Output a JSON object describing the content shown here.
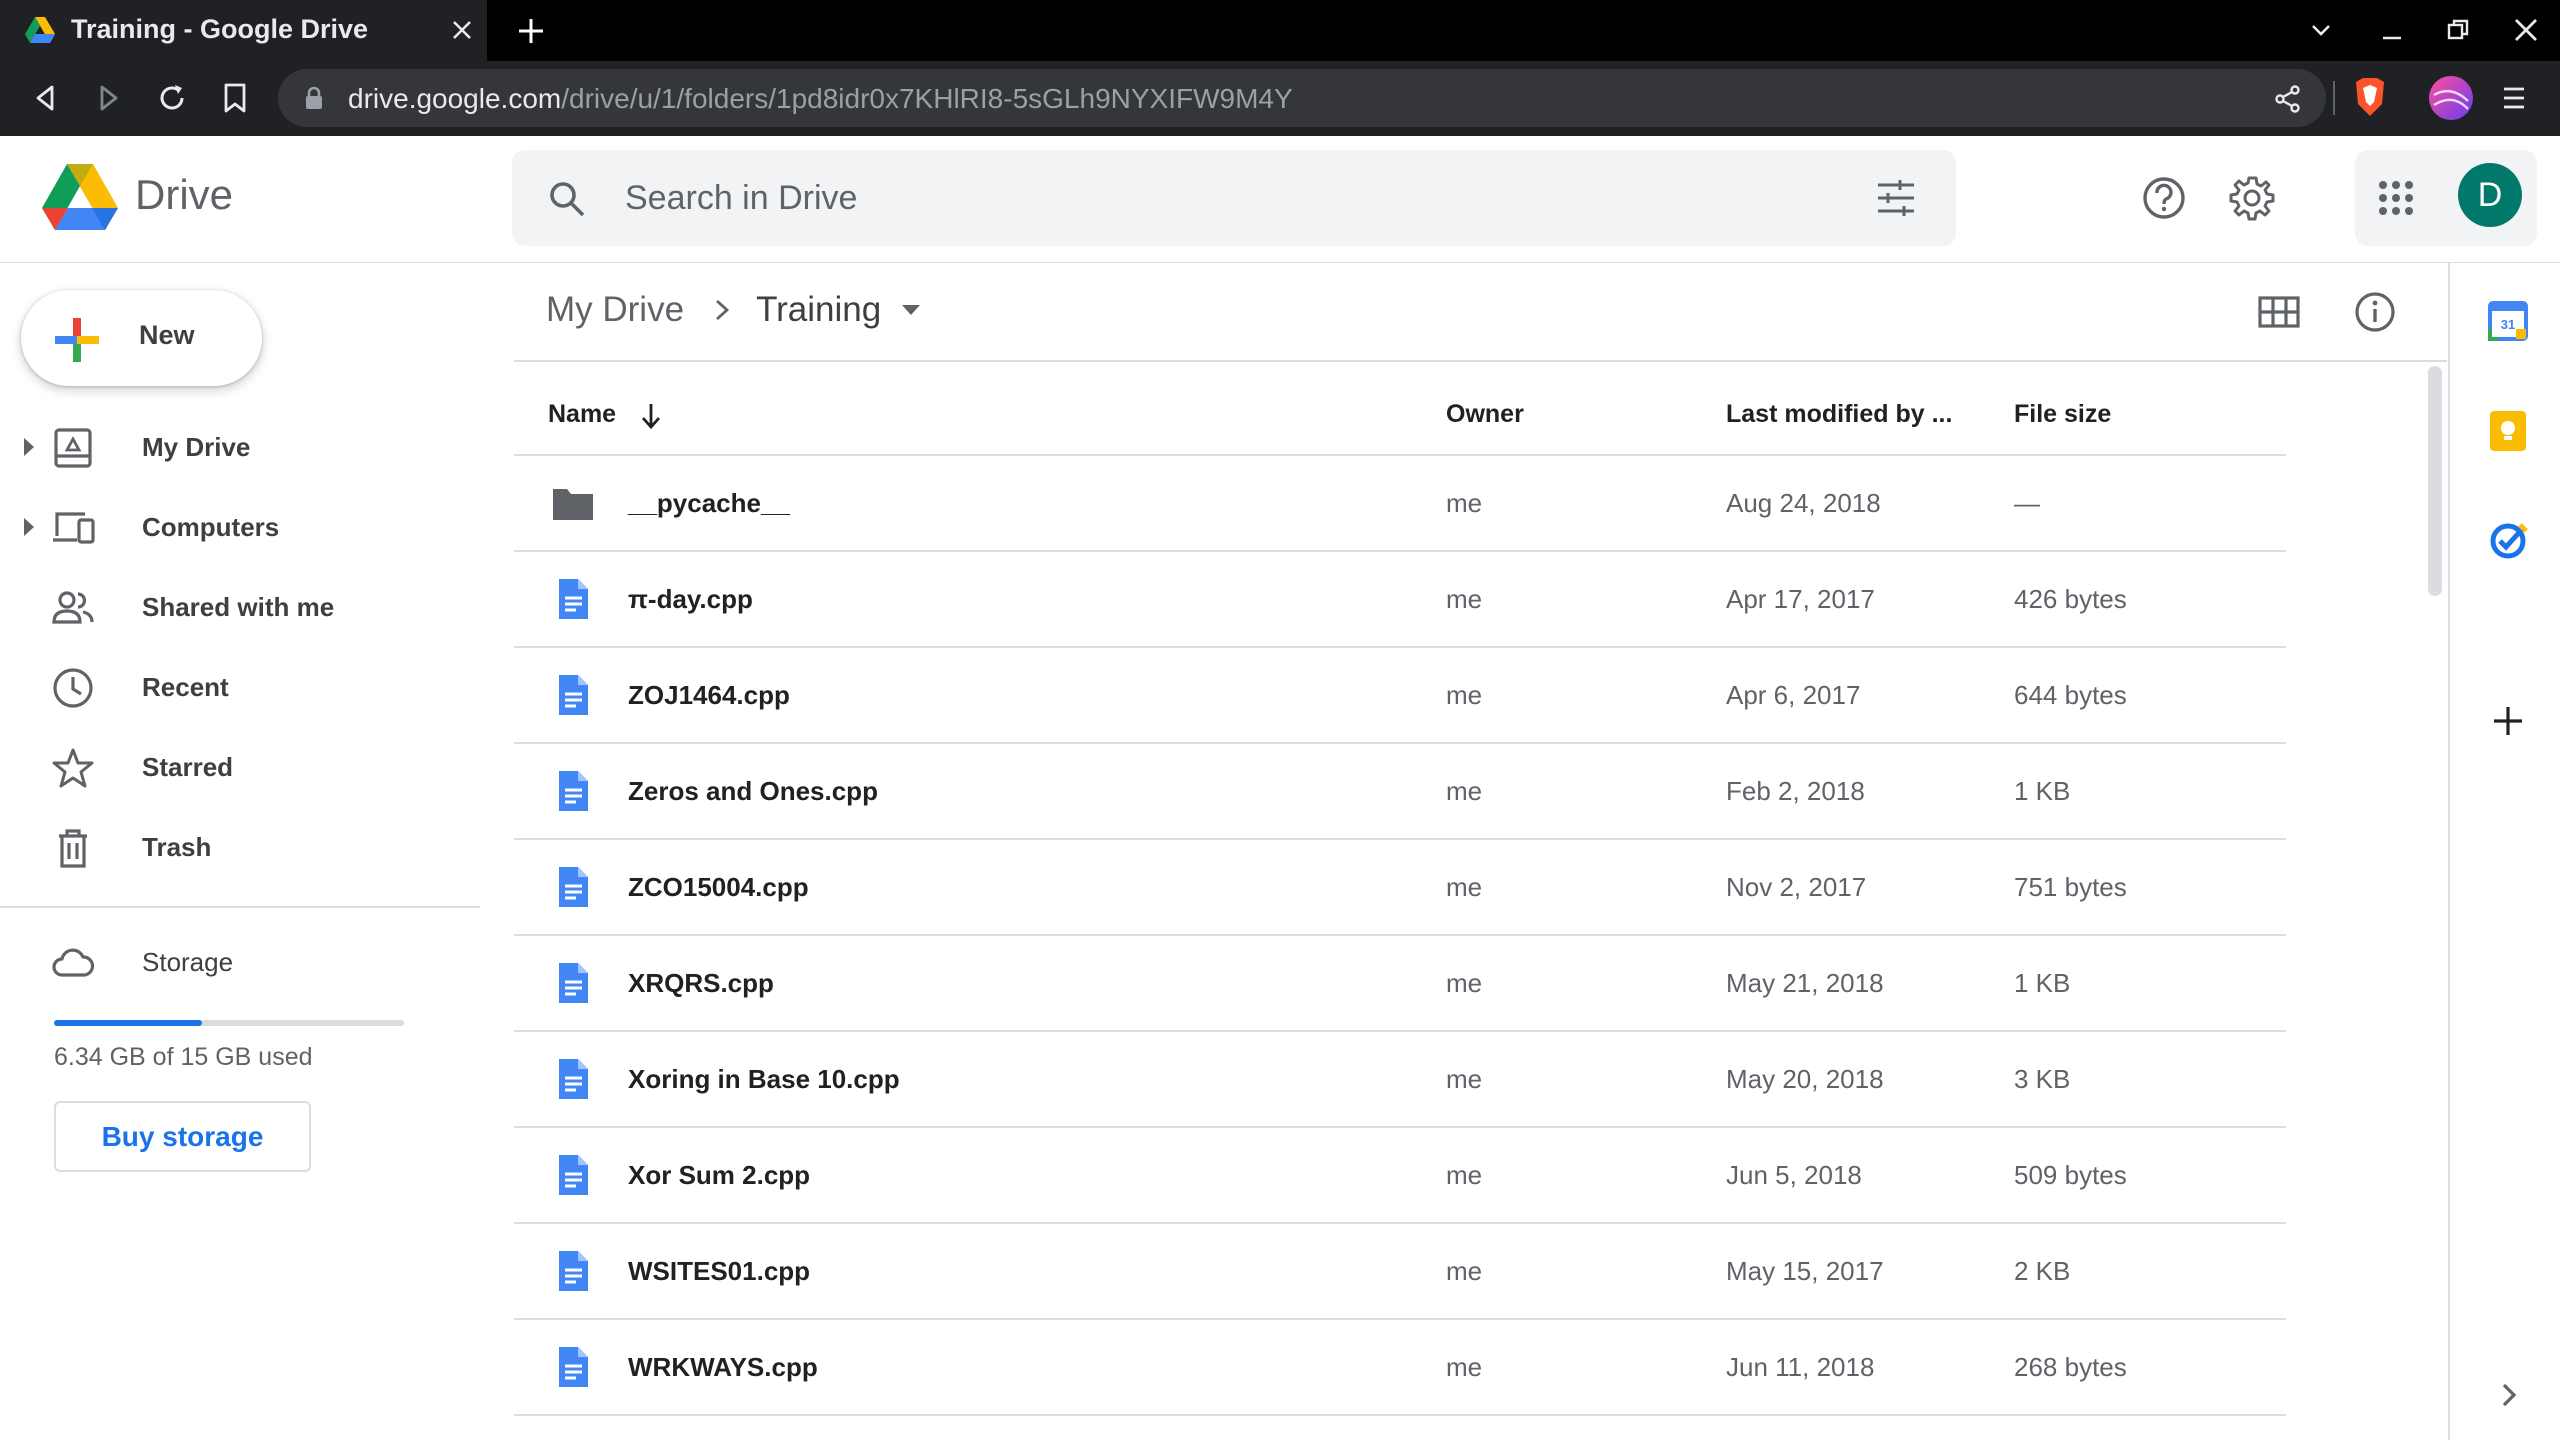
{
  "browser": {
    "tab_title": "Training - Google Drive",
    "url_host": "drive.google.com",
    "url_path": "/drive/u/1/folders/1pd8idr0x7KHlRI8-5sGLh9NYXIFW9M4Y"
  },
  "header": {
    "product_name": "Drive",
    "search_placeholder": "Search in Drive",
    "avatar_letter": "D"
  },
  "sidebar": {
    "new_label": "New",
    "items": [
      {
        "label": "My Drive",
        "icon": "my-drive-icon",
        "expandable": true
      },
      {
        "label": "Computers",
        "icon": "computers-icon",
        "expandable": true
      },
      {
        "label": "Shared with me",
        "icon": "shared-icon",
        "expandable": false
      },
      {
        "label": "Recent",
        "icon": "clock-icon",
        "expandable": false
      },
      {
        "label": "Starred",
        "icon": "star-icon",
        "expandable": false
      },
      {
        "label": "Trash",
        "icon": "trash-icon",
        "expandable": false
      }
    ],
    "storage": {
      "label": "Storage",
      "used_text": "6.34 GB of 15 GB used",
      "used_fraction": 0.4227,
      "buy_label": "Buy storage"
    }
  },
  "breadcrumb": {
    "root": "My Drive",
    "current": "Training"
  },
  "table": {
    "columns": {
      "name": "Name",
      "owner": "Owner",
      "modified": "Last modified by ...",
      "size": "File size"
    },
    "rows": [
      {
        "type": "folder",
        "name": "__pycache__",
        "owner": "me",
        "modified": "Aug 24, 2018",
        "size": "—"
      },
      {
        "type": "doc",
        "name": "π-day.cpp",
        "owner": "me",
        "modified": "Apr 17, 2017",
        "size": "426 bytes"
      },
      {
        "type": "doc",
        "name": "ZOJ1464.cpp",
        "owner": "me",
        "modified": "Apr 6, 2017",
        "size": "644 bytes"
      },
      {
        "type": "doc",
        "name": "Zeros and Ones.cpp",
        "owner": "me",
        "modified": "Feb 2, 2018",
        "size": "1 KB"
      },
      {
        "type": "doc",
        "name": "ZCO15004.cpp",
        "owner": "me",
        "modified": "Nov 2, 2017",
        "size": "751 bytes"
      },
      {
        "type": "doc",
        "name": "XRQRS.cpp",
        "owner": "me",
        "modified": "May 21, 2018",
        "size": "1 KB"
      },
      {
        "type": "doc",
        "name": "Xoring in Base 10.cpp",
        "owner": "me",
        "modified": "May 20, 2018",
        "size": "3 KB"
      },
      {
        "type": "doc",
        "name": "Xor Sum 2.cpp",
        "owner": "me",
        "modified": "Jun 5, 2018",
        "size": "509 bytes"
      },
      {
        "type": "doc",
        "name": "WSITES01.cpp",
        "owner": "me",
        "modified": "May 15, 2017",
        "size": "2 KB"
      },
      {
        "type": "doc",
        "name": "WRKWAYS.cpp",
        "owner": "me",
        "modified": "Jun 11, 2018",
        "size": "268 bytes"
      }
    ]
  },
  "right_rail": {
    "calendar_day": "31"
  },
  "colors": {
    "accent_blue": "#1a73e8",
    "doc_blue": "#4285f4",
    "folder_gray": "#5f6368",
    "avatar_teal": "#00796b"
  }
}
